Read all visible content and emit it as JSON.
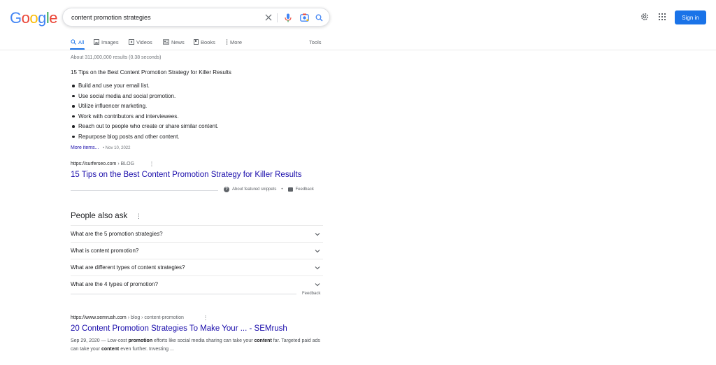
{
  "logo": {
    "letters": [
      "G",
      "o",
      "o",
      "g",
      "l",
      "e"
    ],
    "colors": [
      "#4285f4",
      "#ea4335",
      "#fbbc05",
      "#4285f4",
      "#34a853",
      "#ea4335"
    ]
  },
  "search": {
    "query": "content promotion strategies"
  },
  "header": {
    "sign_in": "Sign in"
  },
  "tabs": [
    {
      "label": "All",
      "icon": "search-icon",
      "active": true
    },
    {
      "label": "Images",
      "icon": "image-icon"
    },
    {
      "label": "Videos",
      "icon": "video-icon"
    },
    {
      "label": "News",
      "icon": "news-icon"
    },
    {
      "label": "Books",
      "icon": "book-icon"
    },
    {
      "label": "More",
      "icon": "more-vert-icon"
    }
  ],
  "tools_label": "Tools",
  "stats": "About 311,000,000 results (0.38 seconds)",
  "featured_snippet": {
    "title": "15 Tips on the Best Content Promotion Strategy for Killer Results",
    "items": [
      "Build and use your email list.",
      "Use social media and social promotion.",
      "Utilize influencer marketing.",
      "Work with contributors and interviewees.",
      "Reach out to people who create or share similar content.",
      "Repurpose blog posts and other content."
    ],
    "more_items": "More items...",
    "date": "• Nov 10, 2022",
    "cite_domain": "https://surferseo.com",
    "cite_path": "› BLOG",
    "result_title": "15 Tips on the Best Content Promotion Strategy for Killer Results",
    "about_snippets": "About featured snippets",
    "dot": "•",
    "feedback": "Feedback"
  },
  "people_also_ask": {
    "title": "People also ask",
    "questions": [
      "What are the 5 promotion strategies?",
      "What is content promotion?",
      "What are different types of content strategies?",
      "What are the 4 types of promotion?"
    ],
    "feedback": "Feedback"
  },
  "result2": {
    "cite_domain": "https://www.semrush.com",
    "cite_path": "› blog › content-promotion",
    "title": "20 Content Promotion Strategies To Make Your ... - SEMrush",
    "snippet_parts": [
      {
        "text": "Sep 29, 2020 — Low-cost ",
        "bold": false
      },
      {
        "text": "promotion",
        "bold": true
      },
      {
        "text": " efforts like social media sharing can take your ",
        "bold": false
      },
      {
        "text": "content",
        "bold": true
      },
      {
        "text": " far. Targeted paid ads can take your ",
        "bold": false
      },
      {
        "text": "content",
        "bold": true
      },
      {
        "text": " even further. Investing ...",
        "bold": false
      }
    ]
  },
  "colors": {
    "link": "#1a0dab",
    "accent": "#1a73e8"
  }
}
